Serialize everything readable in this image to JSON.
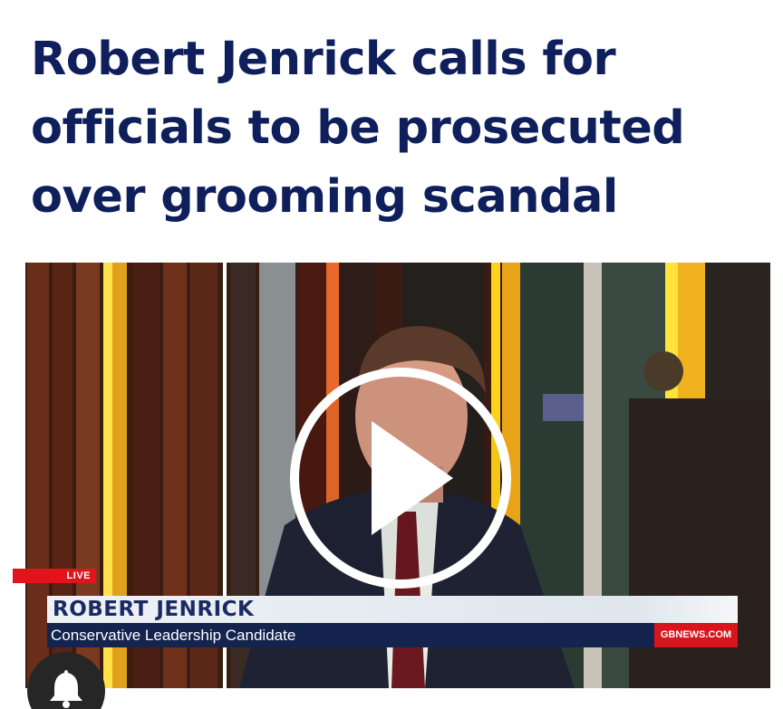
{
  "article": {
    "headline": "Robert Jenrick calls for officials to be prosecuted over grooming scandal"
  },
  "video": {
    "live_label": "LIVE",
    "lower_third_name": "ROBERT JENRICK",
    "lower_third_role": "Conservative Leadership Candidate",
    "channel_tag": "GBNEWS.COM",
    "play_icon": "play-icon"
  },
  "notifications": {
    "icon": "bell-icon"
  },
  "colors": {
    "headline": "#0f1f5c",
    "live_badge": "#e1141b",
    "lower_third_bg": "#14244f",
    "lower_third_name_text": "#1c2a63",
    "channel_tag_bg": "#d8141d",
    "bell_button_bg": "#262626"
  }
}
